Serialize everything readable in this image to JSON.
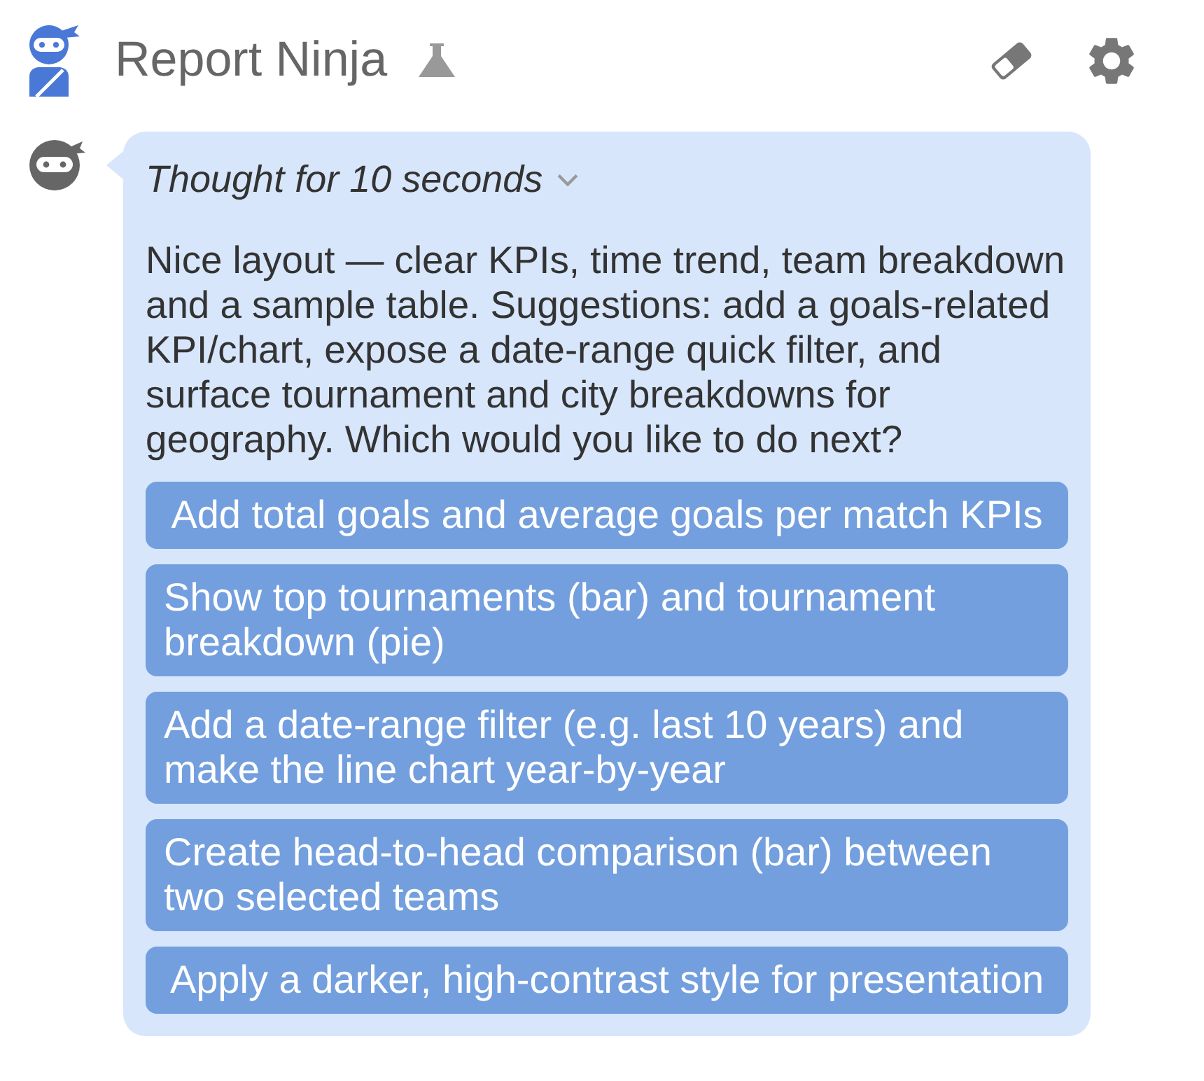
{
  "header": {
    "title": "Report Ninja"
  },
  "message": {
    "thinking": {
      "label": "Thought for 10 seconds",
      "expanded": false
    },
    "text": "Nice layout — clear KPIs, time trend, team breakdown and a sample table. Suggestions: add a goals-related KPI/chart, expose a date-range quick filter, and surface tournament and city breakdowns for geography. Which would you like to do next?",
    "suggestions": [
      "Add total goals and average goals per match KPIs",
      "Show top tournaments (bar) and tournament breakdown (pie)",
      "Add a date-range filter (e.g. last 10 years) and make the line chart year-by-year",
      "Create head-to-head comparison (bar) between two selected teams",
      "Apply a darker, high-contrast style for presentation"
    ]
  }
}
